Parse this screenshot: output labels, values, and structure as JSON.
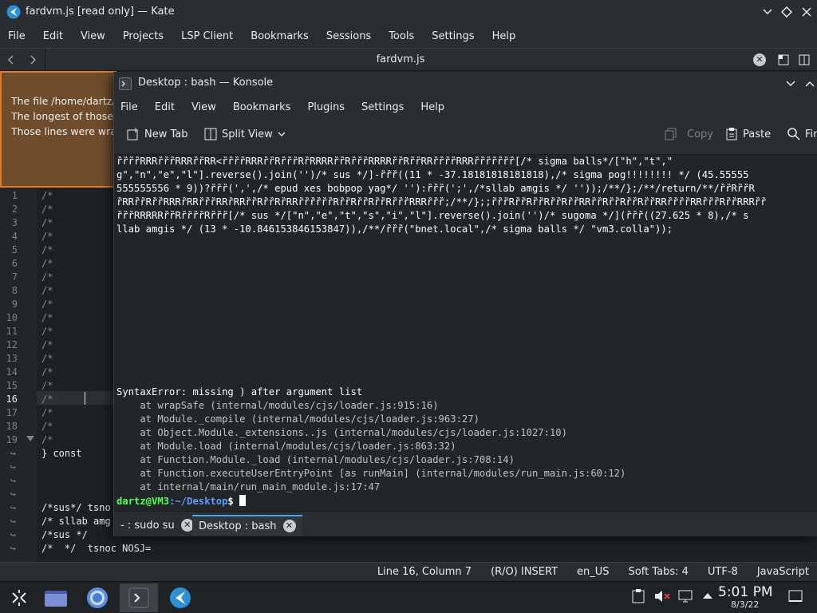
{
  "kate": {
    "title": "fardvm.js [read only] — Kate",
    "menu": [
      "File",
      "Edit",
      "View",
      "Projects",
      "LSP Client",
      "Bookmarks",
      "Sessions",
      "Tools",
      "Settings",
      "Help"
    ],
    "tab_title": "fardvm.js",
    "notification": [
      "The file /home/dartz/",
      "The longest of those",
      "Those lines were wra"
    ],
    "line_numbers": [
      "1",
      "2",
      "3",
      "4",
      "5",
      "6",
      "7",
      "8",
      "9",
      "10",
      "11",
      "12",
      "13",
      "14",
      "15",
      "16",
      "17",
      "18",
      "19"
    ],
    "code_lines": [
      "/*",
      "/*",
      "/*",
      "/*",
      "/*",
      "/*",
      "/*",
      "/*",
      "/*",
      "/*",
      "/*",
      "/*",
      "/*",
      "/*",
      "/*",
      "/*",
      "/*",
      "/*",
      "/*",
      "} const",
      "",
      "",
      "",
      "/*sus*/ tsno",
      "/* sllab amg",
      "/*sus */",
      "/*  */  tsnoc NOSJ="
    ],
    "status": {
      "position": "Line 16, Column 7",
      "mode": "(R/O) INSERT",
      "language": "en_US",
      "tabs": "Soft Tabs: 4",
      "encoding": "UTF-8",
      "syntax": "JavaScript"
    }
  },
  "konsole": {
    "title": "Desktop : bash — Konsole",
    "menu": [
      "File",
      "Edit",
      "View",
      "Bookmarks",
      "Plugins",
      "Settings",
      "Help"
    ],
    "toolbar": {
      "new_tab": "New Tab",
      "split_view": "Split View",
      "copy": "Copy",
      "paste": "Paste",
      "find": "Fin"
    },
    "output_lines": [
      "ȑȑȑȑRRRȑȑȑRRRȑȑRR<ȑȑȑȑRRRȑȑRȑȑȑRȑRRRRȑȑRȑȑȑRRRRȑȑRȑȑRRȑȑȑȑRRRȑȑȑȑȑȑȑ[/* sigma balls*/[\"h\",\"t\",\"",
      "g\",\"n\",\"e\",\"l\"].reverse().join('')/* sus */]-ȑȑȑ((11 * -37.18181818181818),/* sigma pog!!!!!!!! */ (45.55555",
      "555555556 * 9))?ȑȑȑ(',',/* epud xes bobpop yag*/ ''):ȑȑȑ(';',/*sllab amgis */ ''));/**/};/**/return/**/ȑȑRȑȑR",
      "ȑRRȑȑRȑȑRRRȑRRȑȑȑRRȑRRȑȑRȑȑRȑRRȑȑȑȑȑȑRȑȑRȑȑRȑȑRȑȑȑRRRȑȑȑ;/**/};;ȑȑȑRȑȑRȑȑRȑȑRȑȑRRȑȑRȑȑRȑȑRȑȑRRȑȑȑȑRRȑȑȑRȑȑRRRȑȑ",
      "ȑȑȑRRRRRȑȑRȑȑȑȑRȑȑȑ[/* sus */[\"n\",\"e\",\"t\",\"s\",\"i\",\"l\"].reverse().join('')/* sugoma */](ȑȑȑ((27.625 * 8),/* s",
      "llab amgis */ (13 * -10.846153846153847)),/**/ȑȑȑ(\"bnet.local\",/* sigma balls */ \"vm3.colla\"));"
    ],
    "error_lines": [
      "SyntaxError: missing ) after argument list",
      "    at wrapSafe (internal/modules/cjs/loader.js:915:16)",
      "    at Module._compile (internal/modules/cjs/loader.js:963:27)",
      "    at Object.Module._extensions..js (internal/modules/cjs/loader.js:1027:10)",
      "    at Module.load (internal/modules/cjs/loader.js:863:32)",
      "    at Function.Module._load (internal/modules/cjs/loader.js:708:14)",
      "    at Function.executeUserEntryPoint [as runMain] (internal/modules/run_main.js:60:12)",
      "    at internal/main/run_main_module.js:17:47"
    ],
    "prompt_user": "dartz@VM3",
    "prompt_path": ":~/Desktop",
    "prompt_sym": "$",
    "tabs": [
      "- : sudo su",
      "Desktop : bash"
    ]
  },
  "taskbar": {
    "time": "5:01 PM",
    "date": "8/3/22"
  },
  "colors": {
    "accent": "#3daee9",
    "notification_border": "#e07c25",
    "prompt_user": "#54ff54",
    "prompt_path": "#5c9cff"
  }
}
